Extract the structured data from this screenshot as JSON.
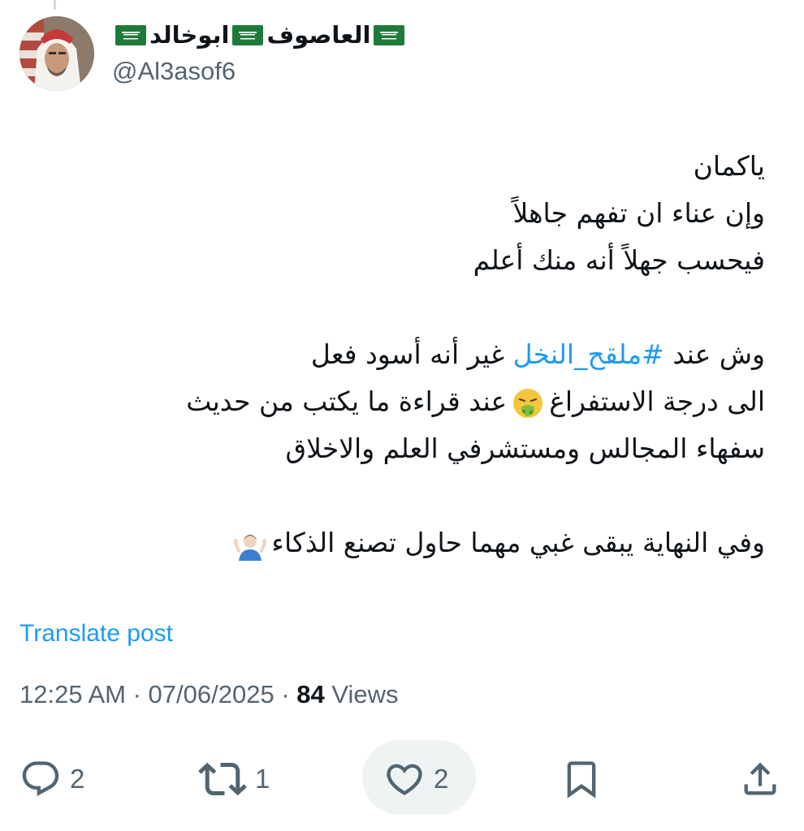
{
  "author": {
    "display_name": "ابوخالد",
    "display_name_2": "العاصوف",
    "handle": "@Al3asof6",
    "flag_icon": "saudi-flag-icon"
  },
  "tweet": {
    "line1": "ياكمان",
    "line2": "وإن عناء ان تفهم جاهلاً",
    "line3": "فيحسب جهلاً أنه منك أعلم",
    "line5_a": "وش عند",
    "hashtag": "#ملقح_النخل",
    "line5_b": " غير أنه أسود فعل",
    "line6_a": "الى درجة الاستفراغ",
    "line6_b": "عند قراءة ما يكتب من حديث",
    "line7": "سفهاء المجالس ومستشرفي العلم والاخلاق",
    "line9": "وفي النهاية يبقى غبي مهما حاول تصنع الذكاء",
    "emoji_1": "nauseated-face-emoji",
    "emoji_2": "person-shrugging-emoji"
  },
  "translate_label": "Translate post",
  "meta": {
    "time": "12:25 AM",
    "separator": " · ",
    "date": "07/06/2025",
    "views_count": "84",
    "views_label": " Views"
  },
  "actions": {
    "replies": "2",
    "reposts": "1",
    "likes": "2"
  },
  "colors": {
    "link": "#1d9bf0",
    "secondary_text": "#536471",
    "primary_text": "#0f1419",
    "like_highlight": "#eff3f4"
  }
}
